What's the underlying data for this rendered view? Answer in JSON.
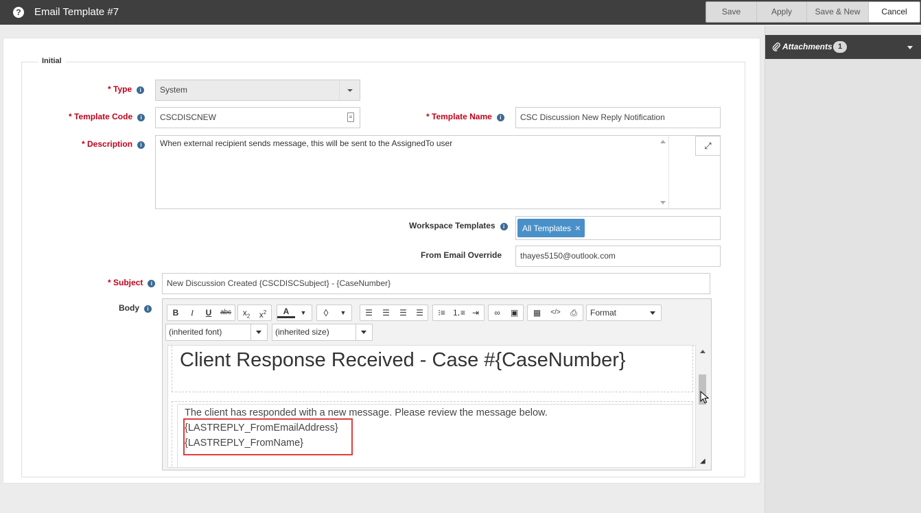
{
  "window": {
    "title": "Email Template #7",
    "help_glyph": "?",
    "actions": [
      "Save",
      "Apply",
      "Save & New",
      "Cancel"
    ]
  },
  "form": {
    "section_label": "Initial",
    "type": {
      "label": "Type",
      "value": "System"
    },
    "template_code": {
      "label": "Template Code",
      "value": "CSCDISCNEW"
    },
    "template_name": {
      "label": "Template Name",
      "value": "CSC Discussion New Reply Notification"
    },
    "description": {
      "label": "Description",
      "value": "When external recipient sends message, this will be sent to the AssignedTo user"
    },
    "workspace_templates": {
      "label": "Workspace Templates",
      "tag": "All Templates",
      "remove_glyph": "×"
    },
    "from_email_override": {
      "label": "From Email Override",
      "value": "thayes5150@outlook.com"
    },
    "subject": {
      "label": "Subject",
      "value": "New Discussion Created  {CSCDISCSubject} - {CaseNumber}"
    },
    "body": {
      "label": "Body"
    },
    "required_marker": "* "
  },
  "editor": {
    "font_select": "(inherited font)",
    "size_select": "(inherited size)",
    "format_select": "Format",
    "heading": "Client Response Received - Case #{CaseNumber}",
    "lines": [
      "The client has responded with a new message. Please review the message below.",
      "{LASTREPLY_FromEmailAddress}",
      "{LASTREPLY_FromName}"
    ]
  },
  "sidebar": {
    "attachments_label": "Attachments",
    "attachments_count": "1"
  },
  "colors": {
    "titlebar": "#3f3f3f",
    "required": "#d40000",
    "tag": "#4a90c8",
    "highlight_box": "#e03c3c"
  },
  "icons": [
    "help-icon",
    "info-icon",
    "expand-icon",
    "paperclip-icon",
    "chevron-down-icon",
    "bold-icon",
    "italic-icon",
    "underline-icon",
    "strikethrough-icon",
    "subscript-icon",
    "superscript-icon",
    "font-color-icon",
    "fill-color-icon",
    "align-left-icon",
    "align-center-icon",
    "align-right-icon",
    "justify-icon",
    "bullet-list-icon",
    "numbered-list-icon",
    "indent-icon",
    "link-icon",
    "image-icon",
    "table-icon",
    "code-icon",
    "print-icon"
  ]
}
